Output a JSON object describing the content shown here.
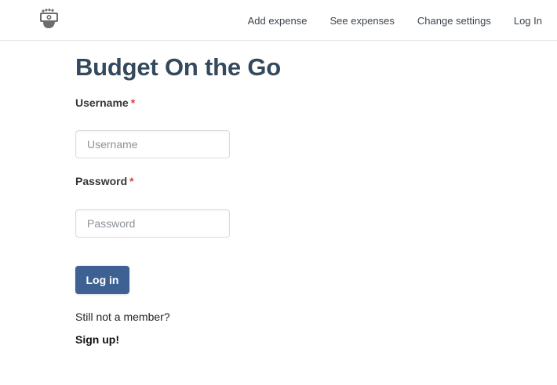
{
  "nav": {
    "logo_icon": "camera-hand-logo",
    "links": [
      "Add expense",
      "See expenses",
      "Change settings",
      "Log In"
    ]
  },
  "page": {
    "title": "Budget On the Go"
  },
  "form": {
    "username": {
      "label": "Username",
      "required_mark": "*",
      "placeholder": "Username",
      "value": ""
    },
    "password": {
      "label": "Password",
      "required_mark": "*",
      "placeholder": "Password",
      "value": ""
    },
    "submit_label": "Log in"
  },
  "footer": {
    "member_text": "Still not a member?",
    "signup_label": "Sign up!"
  },
  "colors": {
    "title": "#34495e",
    "button": "#3e6193",
    "required": "#e33b3b"
  }
}
